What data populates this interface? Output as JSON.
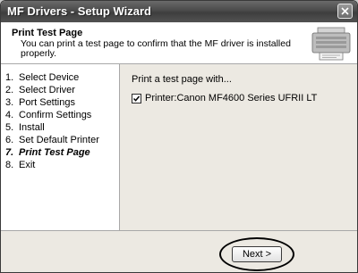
{
  "window": {
    "title": "MF Drivers - Setup Wizard"
  },
  "header": {
    "title": "Print Test Page",
    "description": "You can print a test page to confirm that the MF driver is installed properly."
  },
  "steps": [
    {
      "num": "1.",
      "label": "Select Device"
    },
    {
      "num": "2.",
      "label": "Select Driver"
    },
    {
      "num": "3.",
      "label": "Port Settings"
    },
    {
      "num": "4.",
      "label": "Confirm Settings"
    },
    {
      "num": "5.",
      "label": "Install"
    },
    {
      "num": "6.",
      "label": "Set Default Printer"
    },
    {
      "num": "7.",
      "label": "Print Test Page"
    },
    {
      "num": "8.",
      "label": "Exit"
    }
  ],
  "content": {
    "prompt": "Print a test page with...",
    "printer_label": "Printer:Canon MF4600 Series UFRII LT",
    "printer_checked": true
  },
  "footer": {
    "next_label": "Next >"
  },
  "icons": {
    "close": "close-icon",
    "checkmark": "checkmark-icon",
    "header_graphic": "printer-setup-graphic-icon"
  }
}
